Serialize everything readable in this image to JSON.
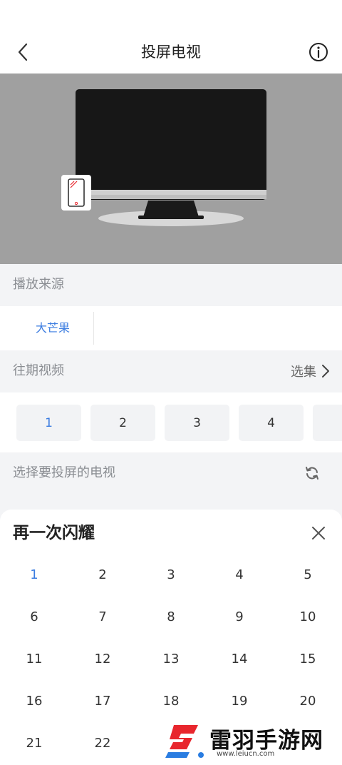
{
  "header": {
    "title": "投屏电视"
  },
  "sections": {
    "source": {
      "label": "播放来源",
      "items": [
        "大芒果"
      ]
    },
    "episodes": {
      "label": "往期视频",
      "select_label": "选集",
      "items": [
        "1",
        "2",
        "3",
        "4"
      ]
    },
    "tv": {
      "label": "选择要投屏的电视"
    }
  },
  "sheet": {
    "title": "再一次闪耀",
    "episodes": [
      "1",
      "2",
      "3",
      "4",
      "5",
      "6",
      "7",
      "8",
      "9",
      "10",
      "11",
      "12",
      "13",
      "14",
      "15",
      "16",
      "17",
      "18",
      "19",
      "20",
      "21",
      "22"
    ],
    "selected": "1"
  },
  "watermark": {
    "text": "雷羽手游网",
    "url": "www.leiucn.com"
  },
  "colors": {
    "accent": "#3b7ce0",
    "hero_bg": "#a0a0a0",
    "logo_red": "#e8262d",
    "logo_blue": "#2a7de1"
  },
  "icons": [
    "back-arrow-icon",
    "info-icon",
    "tv-icon",
    "phone-icon",
    "chevron-right-icon",
    "refresh-icon",
    "close-icon"
  ]
}
